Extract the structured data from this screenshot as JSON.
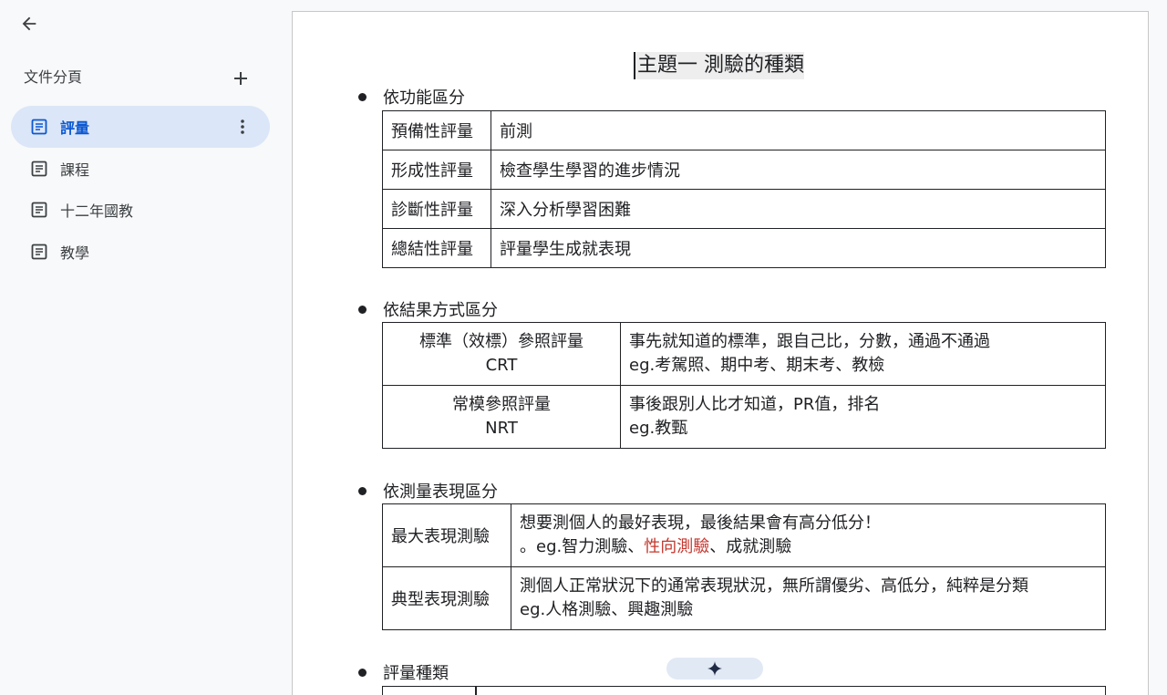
{
  "sidebar": {
    "back_icon": "arrow-back-icon",
    "tabs_title": "文件分頁",
    "add_icon": "plus-icon",
    "items": [
      {
        "label": "評量",
        "icon": "document-icon",
        "active": true
      },
      {
        "label": "課程",
        "icon": "document-icon"
      },
      {
        "label": "十二年國教",
        "icon": "document-icon"
      },
      {
        "label": "教學",
        "icon": "document-icon"
      }
    ],
    "more_icon": "more-vertical-icon"
  },
  "document": {
    "title": "主題一 測驗的種類",
    "sections": [
      {
        "heading": "依功能區分",
        "rows": [
          [
            "預備性評量",
            "前測"
          ],
          [
            "形成性評量",
            "檢查學生學習的進步情況"
          ],
          [
            "診斷性評量",
            "深入分析學習困難"
          ],
          [
            "總結性評量",
            "評量學生成就表現"
          ]
        ]
      },
      {
        "heading": "依結果方式區分",
        "rows": [
          {
            "left1": "標準（效標）參照評量",
            "left2": "CRT",
            "right1": "事先就知道的標準，跟自己比，分數，通過不通過",
            "right2": "eg.考駕照、期中考、期末考、教檢"
          },
          {
            "left1": "常模參照評量",
            "left2": "NRT",
            "right1": "事後跟別人比才知道，PR值，排名",
            "right2": "eg.教甄"
          }
        ]
      },
      {
        "heading": "依測量表現區分",
        "rows": [
          {
            "left": "最大表現測驗",
            "right1": "想要測個人的最好表現，最後結果會有高分低分！",
            "right2_a": "。eg.智力測驗、",
            "right2_b": "性向測驗",
            "right2_c": "、成就測驗"
          },
          {
            "left": "典型表現測驗",
            "right1": "測個人正常狀況下的通常表現狀況，無所謂優劣、高低分，純粹是分類",
            "right2": "eg.人格測驗、興趣測驗"
          }
        ]
      },
      {
        "heading": "評量種類"
      }
    ]
  },
  "gemini_chip_icon": "sparkle-icon",
  "colors": {
    "active_tab_bg": "#dbe6f8",
    "active_text": "#0b57d0",
    "highlight_red": "#c5372e"
  }
}
